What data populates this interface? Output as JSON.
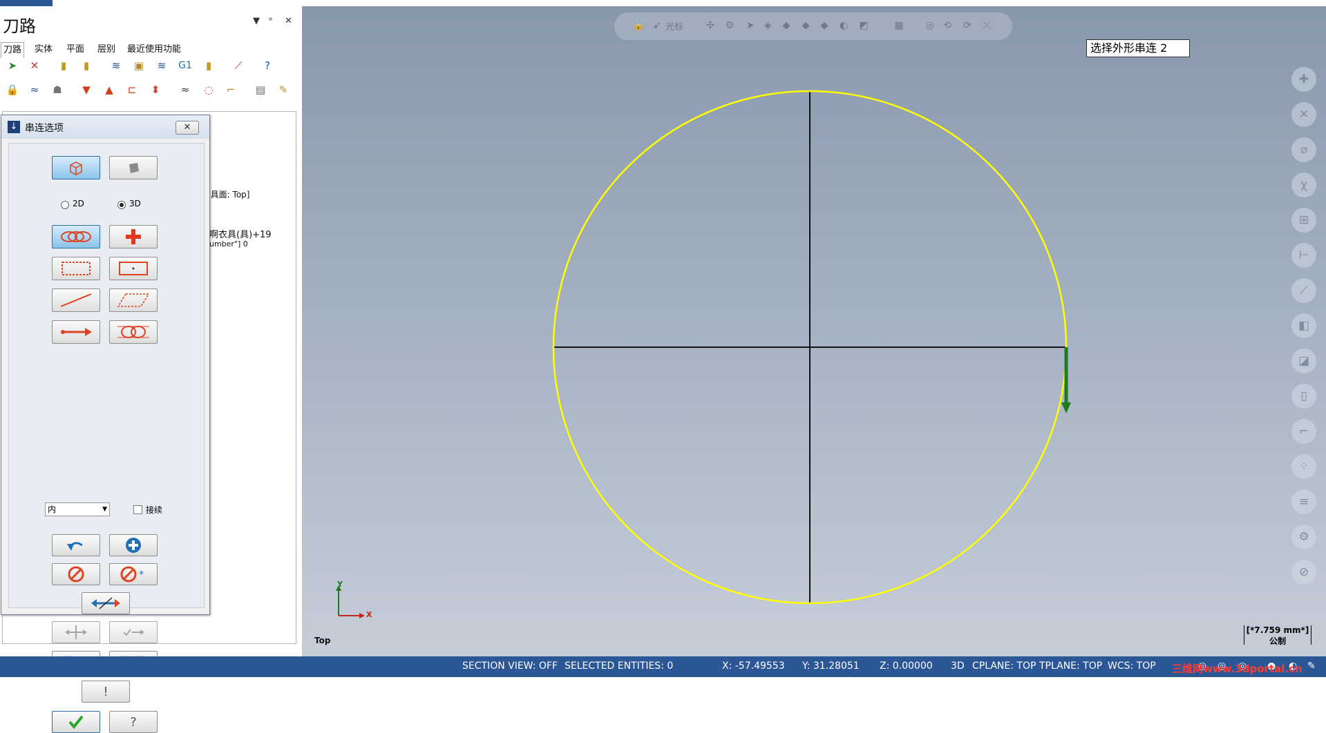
{
  "panel": {
    "title": "刀路",
    "controls": [
      "▼",
      "ᵒ",
      "✕"
    ],
    "tabs": [
      "刀路",
      "实体",
      "平面",
      "层别",
      "最近使用功能"
    ]
  },
  "tree": {
    "lines": [
      "]具面: Top]",
      "啊衣具(具)+19",
      "umber\"] 0"
    ]
  },
  "chain_dialog": {
    "title": "串连选项",
    "radio_2d": "2D",
    "radio_3d": "3D",
    "mode_value": "内",
    "continue_label": "接续",
    "close_glyph": "✕"
  },
  "viewport": {
    "prompt": "选择外形串连  2",
    "view_name": "Top",
    "axis_x": "X",
    "axis_y": "Y",
    "scale_value": "[*7.759 mm*]",
    "scale_unit": "公制",
    "qat_label": "光标"
  },
  "status": {
    "section_view": "SECTION VIEW: OFF",
    "selected": "SELECTED ENTITIES: 0",
    "x": "X:   -57.49553",
    "y": "Y:  31.28051",
    "z": "Z:  0.00000",
    "mode": "3D",
    "cplane": "CPLANE: TOP",
    "tplane": "TPLANE: TOP",
    "wcs": "WCS: TOP"
  },
  "watermark": "三维网www.3dportal.cn",
  "colors": {
    "accent": "#2b5797",
    "circle": "#ffff00",
    "arrow": "#1e7a1e"
  }
}
